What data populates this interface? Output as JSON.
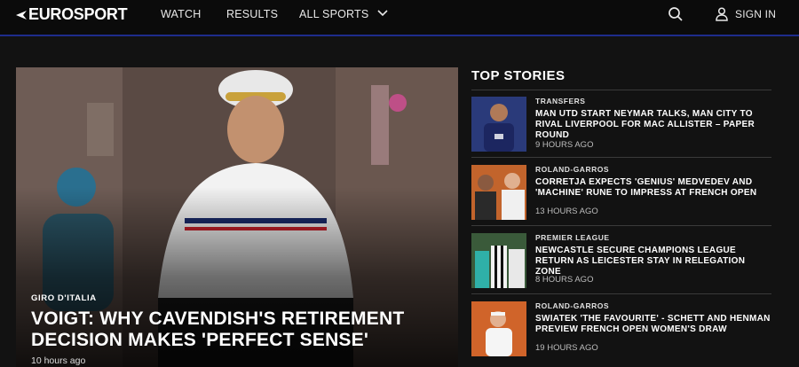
{
  "header": {
    "logo_text": "EUROSPORT",
    "nav": {
      "watch": "WATCH",
      "results": "RESULTS",
      "all_sports": "ALL SPORTS"
    },
    "sign_in": "SIGN IN",
    "icons": [
      "search-icon",
      "user-icon",
      "chevron-down-icon"
    ]
  },
  "hero": {
    "category": "GIRO D'ITALIA",
    "title": "VOIGT: WHY CAVENDISH'S RETIREMENT DECISION MAKES 'PERFECT SENSE'",
    "time": "10 hours ago"
  },
  "top_stories": {
    "heading": "TOP STORIES",
    "items": [
      {
        "category": "TRANSFERS",
        "title": "MAN UTD START NEYMAR TALKS, MAN CITY TO RIVAL LIVERPOOL FOR MAC ALLISTER – PAPER ROUND",
        "time": "9 HOURS AGO"
      },
      {
        "category": "ROLAND-GARROS",
        "title": "CORRETJA EXPECTS 'GENIUS' MEDVEDEV AND 'MACHINE' RUNE TO IMPRESS AT FRENCH OPEN",
        "time": "13 HOURS AGO"
      },
      {
        "category": "PREMIER LEAGUE",
        "title": "NEWCASTLE SECURE CHAMPIONS LEAGUE RETURN AS LEICESTER STAY IN RELEGATION ZONE",
        "time": "8 HOURS AGO"
      },
      {
        "category": "ROLAND-GARROS",
        "title": "SWIATEK 'THE FAVOURITE' - SCHETT AND HENMAN PREVIEW FRENCH OPEN WOMEN'S DRAW",
        "time": "19 HOURS AGO"
      }
    ]
  },
  "colors": {
    "background": "#121212",
    "topbar": "#0b0b0b",
    "accent_line": "#1e2c8c"
  }
}
